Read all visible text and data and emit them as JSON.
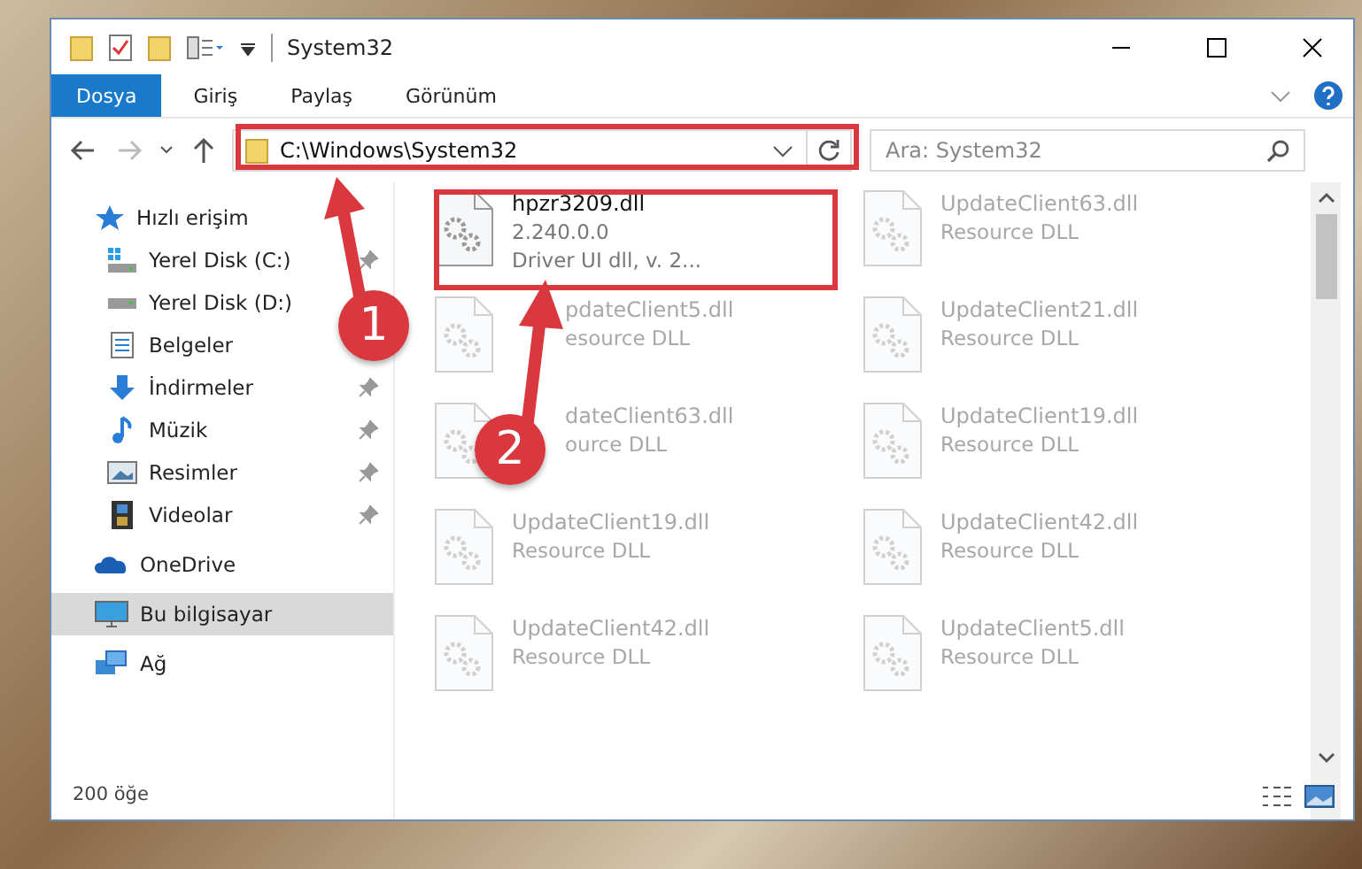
{
  "window": {
    "title": "System32"
  },
  "ribbon": {
    "tabs": [
      {
        "label": "Dosya",
        "selected": true
      },
      {
        "label": "Giriş",
        "selected": false
      },
      {
        "label": "Paylaş",
        "selected": false
      },
      {
        "label": "Görünüm",
        "selected": false
      }
    ]
  },
  "address": {
    "path": "C:\\Windows\\System32",
    "search_placeholder": "Ara: System32"
  },
  "sidebar": {
    "items": [
      {
        "label": "Hızlı erişim",
        "kind": "star",
        "selected": false,
        "children": [
          {
            "label": "Yerel Disk (C:)",
            "kind": "drive-c",
            "pinned": true,
            "selected": false
          },
          {
            "label": "Yerel Disk (D:)",
            "kind": "drive",
            "pinned": false,
            "selected": false
          },
          {
            "label": "Belgeler",
            "kind": "docs",
            "pinned": false,
            "selected": false
          },
          {
            "label": "İndirmeler",
            "kind": "download",
            "pinned": true,
            "selected": false
          },
          {
            "label": "Müzik",
            "kind": "music",
            "pinned": true,
            "selected": false
          },
          {
            "label": "Resimler",
            "kind": "pictures",
            "pinned": true,
            "selected": false
          },
          {
            "label": "Videolar",
            "kind": "videos",
            "pinned": true,
            "selected": false
          }
        ]
      },
      {
        "label": "OneDrive",
        "kind": "cloud",
        "selected": false
      },
      {
        "label": "Bu bilgisayar",
        "kind": "pc",
        "selected": true
      },
      {
        "label": "Ağ",
        "kind": "network",
        "selected": false
      }
    ]
  },
  "files": [
    {
      "name": "hpzr3209.dll",
      "lines": [
        "2.240.0.0",
        "Driver UI dll, v. 2..."
      ],
      "faded": false
    },
    {
      "name": "UpdateClient63.dll",
      "lines": [
        "Resource DLL"
      ],
      "faded": true
    },
    {
      "name": "pdateClient5.dll",
      "lines": [
        "esource DLL"
      ],
      "faded": true,
      "covered": true
    },
    {
      "name": "UpdateClient21.dll",
      "lines": [
        "Resource DLL"
      ],
      "faded": true
    },
    {
      "name": "dateClient63.dll",
      "lines": [
        "ource DLL"
      ],
      "faded": true,
      "covered": true
    },
    {
      "name": "UpdateClient19.dll",
      "lines": [
        "Resource DLL"
      ],
      "faded": true
    },
    {
      "name": "UpdateClient19.dll",
      "lines": [
        "Resource DLL"
      ],
      "faded": true
    },
    {
      "name": "UpdateClient42.dll",
      "lines": [
        "Resource DLL"
      ],
      "faded": true
    },
    {
      "name": "UpdateClient42.dll",
      "lines": [
        "Resource DLL"
      ],
      "faded": true
    },
    {
      "name": "UpdateClient5.dll",
      "lines": [
        "Resource DLL"
      ],
      "faded": true
    }
  ],
  "status_bar": {
    "count": "200 öğe"
  },
  "annotations": [
    {
      "number": "1"
    },
    {
      "number": "2"
    }
  ]
}
